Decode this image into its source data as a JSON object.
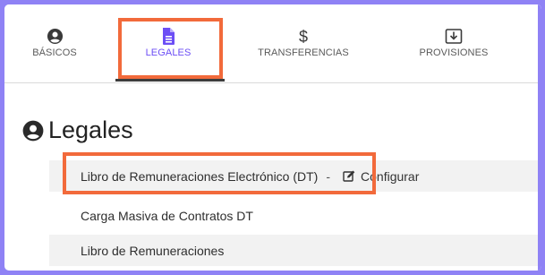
{
  "tabs": [
    {
      "label": "BÁSICOS",
      "icon": "user-circle-icon"
    },
    {
      "label": "LEGALES",
      "icon": "document-icon",
      "active": true
    },
    {
      "label": "TRANSFERENCIAS",
      "icon": "dollar-icon"
    },
    {
      "label": "PROVISIONES",
      "icon": "download-box-icon"
    }
  ],
  "section": {
    "title": "Legales",
    "icon": "user-circle-icon"
  },
  "rows": [
    {
      "label": "Libro de Remuneraciones Electrónico (DT)",
      "separator": "-",
      "action_label": "Configurar",
      "action_icon": "edit-icon"
    },
    {
      "label": "Carga Masiva de Contratos DT"
    },
    {
      "label": "Libro de Remuneraciones"
    }
  ],
  "colors": {
    "accent": "#6c4ef5",
    "highlight": "#f26a3b",
    "frame": "#8f82f5"
  }
}
